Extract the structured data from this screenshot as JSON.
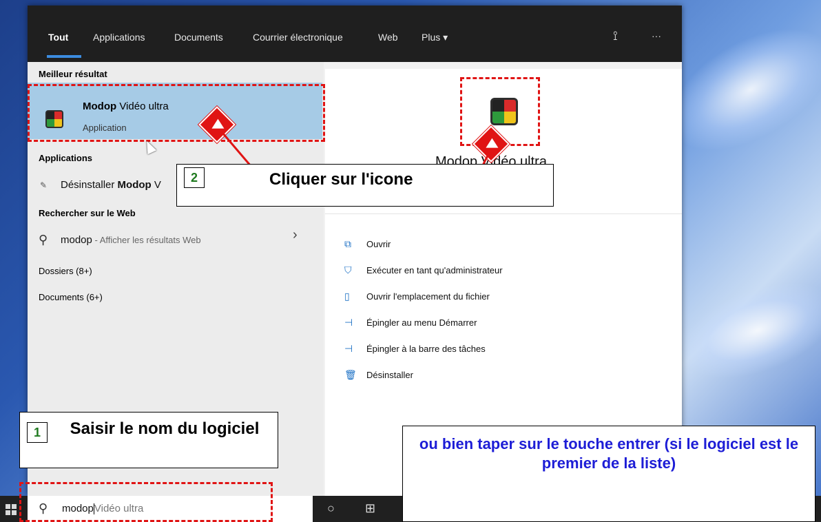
{
  "tabs": [
    "Tout",
    "Applications",
    "Documents",
    "Courrier électronique",
    "Web",
    "Plus ▾"
  ],
  "top_icons": {
    "feedback": "⟟",
    "more": "···"
  },
  "left": {
    "best_match_title": "Meilleur résultat",
    "best_match": {
      "name_bold": "Modop",
      "name_rest": " Vidéo ultra",
      "type": "Application"
    },
    "apps_title": "Applications",
    "apps_item": {
      "prefix": "Désinstaller ",
      "bold": "Modop",
      "suffix": " V"
    },
    "web_title": "Rechercher sur le Web",
    "web_item": {
      "term": "modop",
      "sub": " - Afficher les résultats Web"
    },
    "folders": "Dossiers (8+)",
    "documents": "Documents (6+)"
  },
  "right": {
    "app_name": "Modop Vidéo ultra",
    "actions": [
      {
        "icon": "open-icon",
        "glyph": "⧉",
        "label": "Ouvrir"
      },
      {
        "icon": "admin-icon",
        "glyph": "⛉",
        "label": "Exécuter en tant qu'administrateur"
      },
      {
        "icon": "file-location-icon",
        "glyph": "▯",
        "label": "Ouvrir l'emplacement du fichier"
      },
      {
        "icon": "pin-icon",
        "glyph": "⊣",
        "label": "Épingler au menu Démarrer"
      },
      {
        "icon": "pin-icon",
        "glyph": "⊣",
        "label": "Épingler à la barre des tâches"
      },
      {
        "icon": "trash-icon",
        "glyph": "🗑",
        "label": "Désinstaller"
      }
    ]
  },
  "search": {
    "query": "modop",
    "completion": "Vidéo ultra"
  },
  "annotations": {
    "step1_num": "1",
    "step1_text": "Saisir le nom du logiciel",
    "step2_num": "2",
    "step2_text": "Cliquer sur l'icone",
    "note": "ou bien taper sur le touche entrer (si le logiciel est le premier de la liste)"
  },
  "colors": {
    "annotation_red": "#e01414",
    "selected_bg": "#a6cbe6",
    "note_blue": "#1d1dd6"
  }
}
